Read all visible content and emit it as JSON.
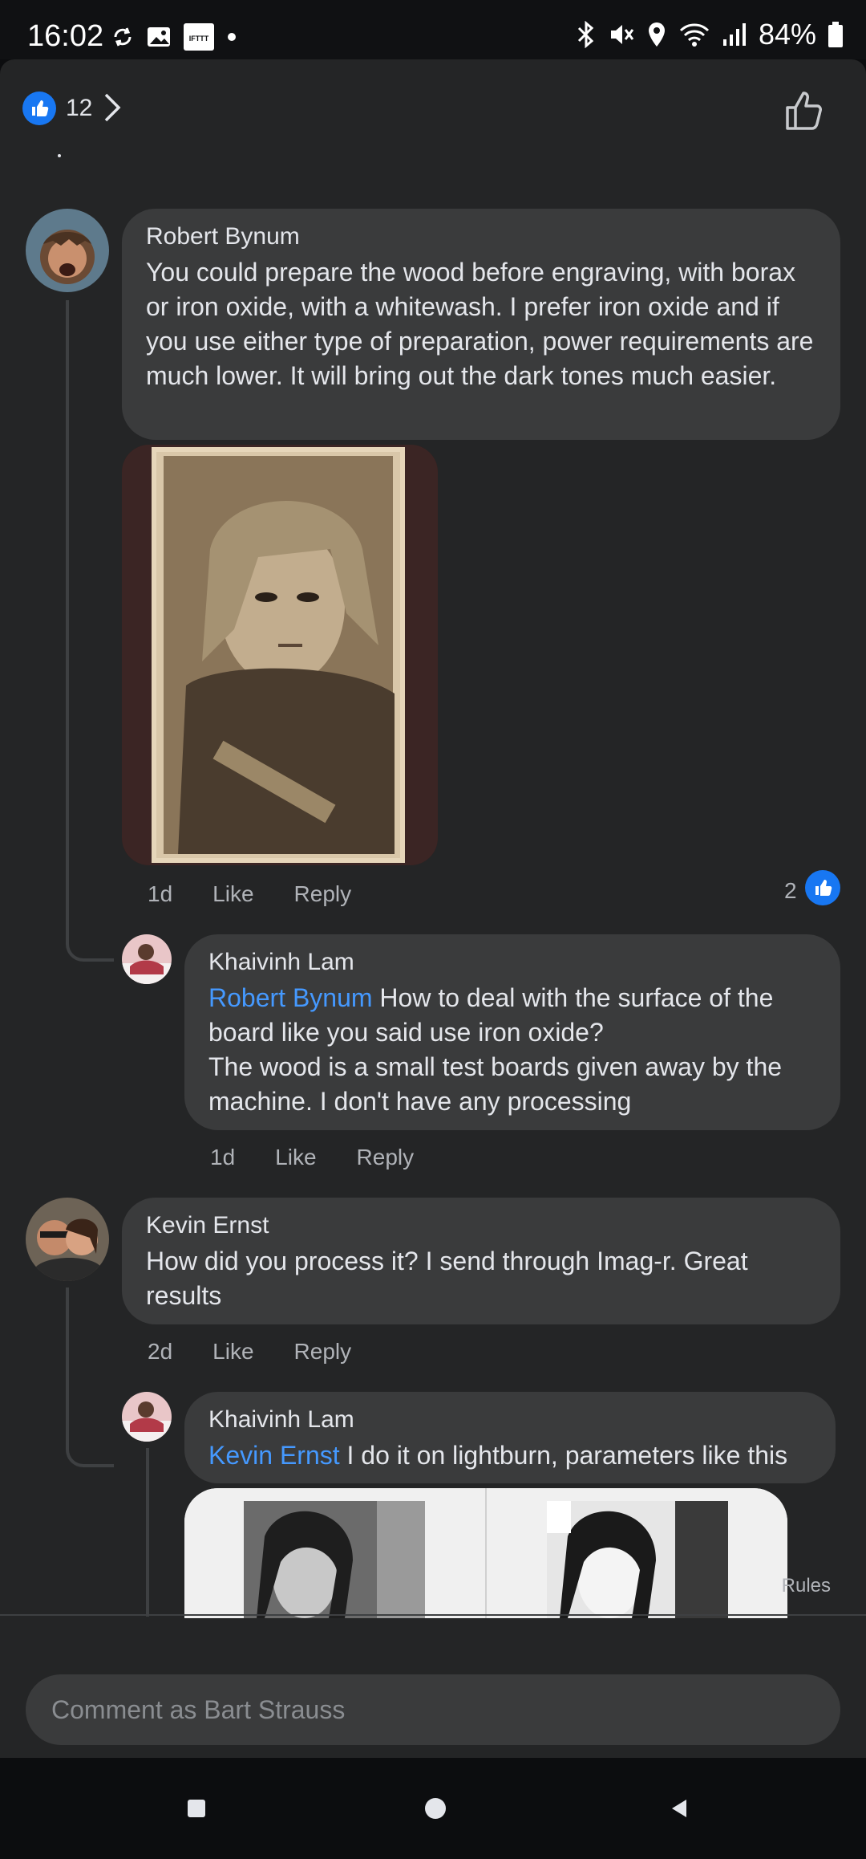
{
  "status_bar": {
    "time": "16:02",
    "battery": "84%"
  },
  "top_bar": {
    "like_count": "12"
  },
  "comments": [
    {
      "author": "Robert Bynum",
      "text": "You could prepare the wood before engraving, with borax or iron oxide, with a whitewash.  I prefer iron oxide and if you use either type of preparation, power requirements are much lower.  It will bring out the dark tones much easier.",
      "time": "1d",
      "like": "Like",
      "reply": "Reply",
      "reaction_count": "2"
    },
    {
      "author": "Khaivinh Lam",
      "mention": "Robert Bynum",
      "text": "How to deal with the surface of the board like you said use iron oxide?",
      "text2": "The wood is a small test boards given away by the machine. I don't have any processing",
      "time": "1d",
      "like": "Like",
      "reply": "Reply"
    },
    {
      "author": "Kevin Ernst",
      "text": "How did you process it? I send through Imag-r. Great results",
      "time": "2d",
      "like": "Like",
      "reply": "Reply"
    },
    {
      "author": "Khaivinh Lam",
      "mention": "Kevin Ernst",
      "text": "I do it on lightburn, parameters like this"
    }
  ],
  "footer": {
    "rules": "Rules",
    "comment_placeholder": "Comment as Bart Strauss"
  },
  "colors": {
    "panel": "#242526",
    "bubble": "#3a3b3c",
    "mention": "#4599ff",
    "like_blue": "#1877f2"
  }
}
